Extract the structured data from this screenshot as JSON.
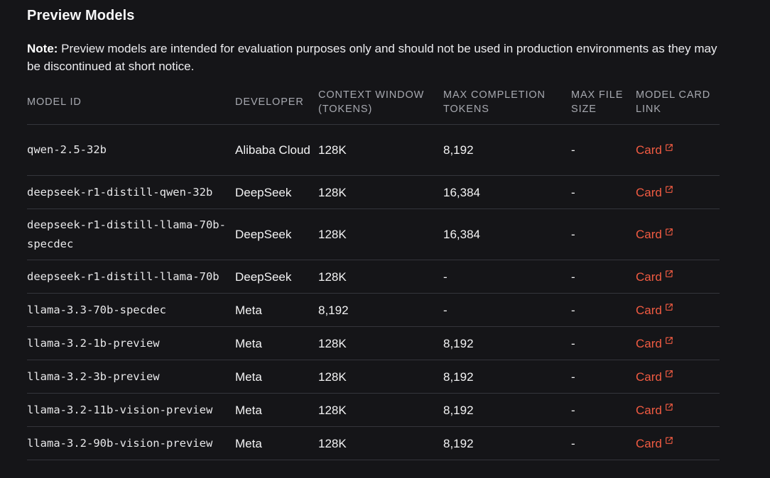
{
  "title": "Preview Models",
  "note": {
    "label": "Note:",
    "text": " Preview models are intended for evaluation purposes only and should not be used in production environments as they may be discontinued at short notice."
  },
  "table": {
    "headers": {
      "model_id": "MODEL ID",
      "developer": "DEVELOPER",
      "context_window": "CONTEXT WINDOW (TOKENS)",
      "max_completion": "MAX COMPLETION TOKENS",
      "max_file_size": "MAX FILE SIZE",
      "model_card": "MODEL CARD LINK"
    },
    "rows": [
      {
        "model_id": "qwen-2.5-32b",
        "developer": "Alibaba Cloud",
        "context_window": "128K",
        "max_completion": "8,192",
        "max_file_size": "-",
        "card": "Card"
      },
      {
        "model_id": "deepseek-r1-distill-qwen-32b",
        "developer": "DeepSeek",
        "context_window": "128K",
        "max_completion": "16,384",
        "max_file_size": "-",
        "card": "Card"
      },
      {
        "model_id": "deepseek-r1-distill-llama-70b-specdec",
        "developer": "DeepSeek",
        "context_window": "128K",
        "max_completion": "16,384",
        "max_file_size": "-",
        "card": "Card"
      },
      {
        "model_id": "deepseek-r1-distill-llama-70b",
        "developer": "DeepSeek",
        "context_window": "128K",
        "max_completion": "-",
        "max_file_size": "-",
        "card": "Card"
      },
      {
        "model_id": "llama-3.3-70b-specdec",
        "developer": "Meta",
        "context_window": "8,192",
        "max_completion": "-",
        "max_file_size": "-",
        "card": "Card"
      },
      {
        "model_id": "llama-3.2-1b-preview",
        "developer": "Meta",
        "context_window": "128K",
        "max_completion": "8,192",
        "max_file_size": "-",
        "card": "Card"
      },
      {
        "model_id": "llama-3.2-3b-preview",
        "developer": "Meta",
        "context_window": "128K",
        "max_completion": "8,192",
        "max_file_size": "-",
        "card": "Card"
      },
      {
        "model_id": "llama-3.2-11b-vision-preview",
        "developer": "Meta",
        "context_window": "128K",
        "max_completion": "8,192",
        "max_file_size": "-",
        "card": "Card"
      },
      {
        "model_id": "llama-3.2-90b-vision-preview",
        "developer": "Meta",
        "context_window": "128K",
        "max_completion": "8,192",
        "max_file_size": "-",
        "card": "Card"
      }
    ]
  },
  "colors": {
    "background": "#151518",
    "link": "#f15b42",
    "header_text": "#a7a9b0",
    "divider": "#34353b"
  },
  "icons": {
    "card_link": "external-link-icon"
  }
}
